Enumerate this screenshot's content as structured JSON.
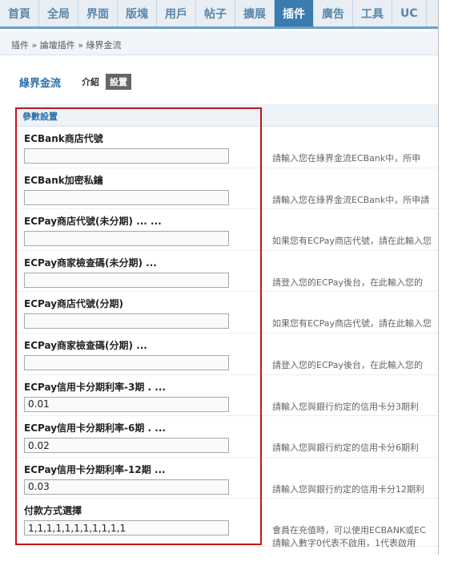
{
  "nav": {
    "items": [
      "首頁",
      "全局",
      "界面",
      "版塊",
      "用戶",
      "帖子",
      "擴展",
      "插件",
      "廣告",
      "工具",
      "UC"
    ],
    "active_index": 7
  },
  "breadcrumb": {
    "text": "插件 » 論壇插件 » 綠界金流"
  },
  "header": {
    "title": "綠界金流",
    "tab_intro": "介紹",
    "tab_settings": "設置"
  },
  "section": {
    "title": "參數設置"
  },
  "settings": [
    {
      "label": "ECBank商店代號",
      "value": "",
      "hint": "請輸入您在綠界金流ECBank中，所申"
    },
    {
      "label": "ECBank加密私鑰",
      "value": "",
      "hint": "請輸入您在綠界金流ECBank中，所申請"
    },
    {
      "label": "ECPay商店代號(未分期) ... ...",
      "value": "",
      "hint": "如果您有ECPay商店代號，請在此輸入您"
    },
    {
      "label": "ECPay商家檢查碼(未分期) ...",
      "value": "",
      "hint": "請登入您的ECPay後台，在此輸入您的"
    },
    {
      "label": "ECPay商店代號(分期)",
      "value": "",
      "hint": "如果您有ECPay商店代號，請在此輸入您"
    },
    {
      "label": "ECPay商家檢查碼(分期) ...",
      "value": "",
      "hint": "請登入您的ECPay後台，在此輸入您的"
    },
    {
      "label": "ECPay信用卡分期利率-3期 . ...",
      "value": "0.01",
      "hint": "請輸入您與銀行約定的信用卡分3期利"
    },
    {
      "label": "ECPay信用卡分期利率-6期 . ...",
      "value": "0.02",
      "hint": "請輸入您與銀行約定的信用卡分6期利"
    },
    {
      "label": "ECPay信用卡分期利率-12期 ...",
      "value": "0.03",
      "hint": "請輸入您與銀行約定的信用卡分12期利"
    },
    {
      "label": "付款方式選擇",
      "value": "1,1,1,1,1,1,1,1,1,1,1",
      "hint": "會員在充值時，可以使用ECBANK或EC",
      "hint2": "請輸入數字0代表不啟用，1代表啟用"
    }
  ],
  "colors": {
    "nav_active": "#3a7bb0",
    "accent_text": "#2a6fa8",
    "highlight_box": "#c01818"
  }
}
